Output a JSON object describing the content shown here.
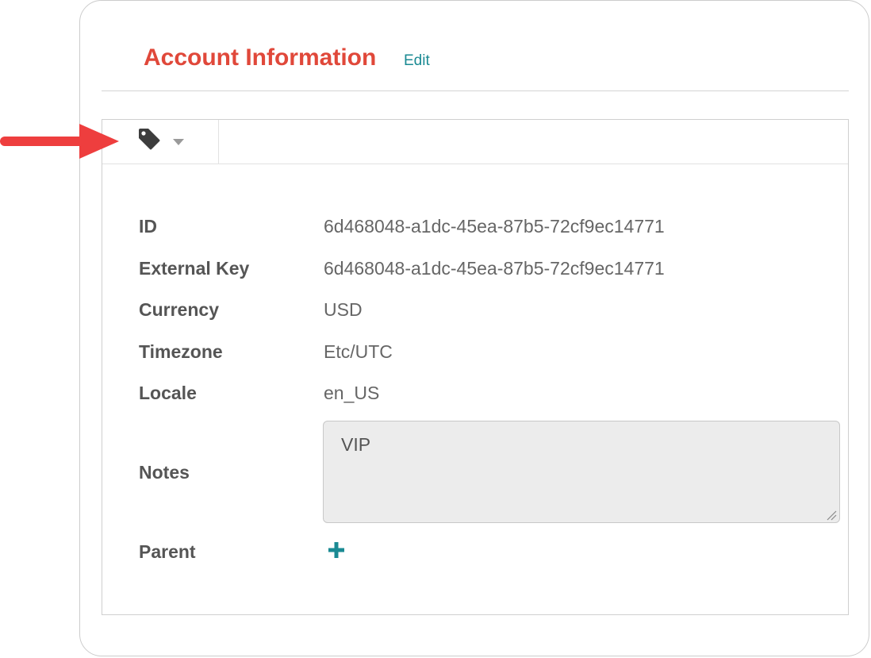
{
  "header": {
    "title": "Account Information",
    "edit_label": "Edit"
  },
  "toolbar": {
    "tag_icon": "tag-icon",
    "dropdown_icon": "caret-down-icon"
  },
  "fields": {
    "id": {
      "label": "ID",
      "value": "6d468048-a1dc-45ea-87b5-72cf9ec14771"
    },
    "external_key": {
      "label": "External Key",
      "value": "6d468048-a1dc-45ea-87b5-72cf9ec14771"
    },
    "currency": {
      "label": "Currency",
      "value": "USD"
    },
    "timezone": {
      "label": "Timezone",
      "value": "Etc/UTC"
    },
    "locale": {
      "label": "Locale",
      "value": "en_US"
    },
    "notes": {
      "label": "Notes",
      "value": "VIP"
    },
    "parent": {
      "label": "Parent",
      "add_icon": "plus-icon"
    }
  },
  "annotation": {
    "icon": "red-arrow-icon"
  },
  "colors": {
    "title": "#e0483a",
    "link": "#1a8a93",
    "arrow": "#ee3e3e",
    "label": "#555555",
    "value": "#666666",
    "notes_bg": "#ececec"
  }
}
